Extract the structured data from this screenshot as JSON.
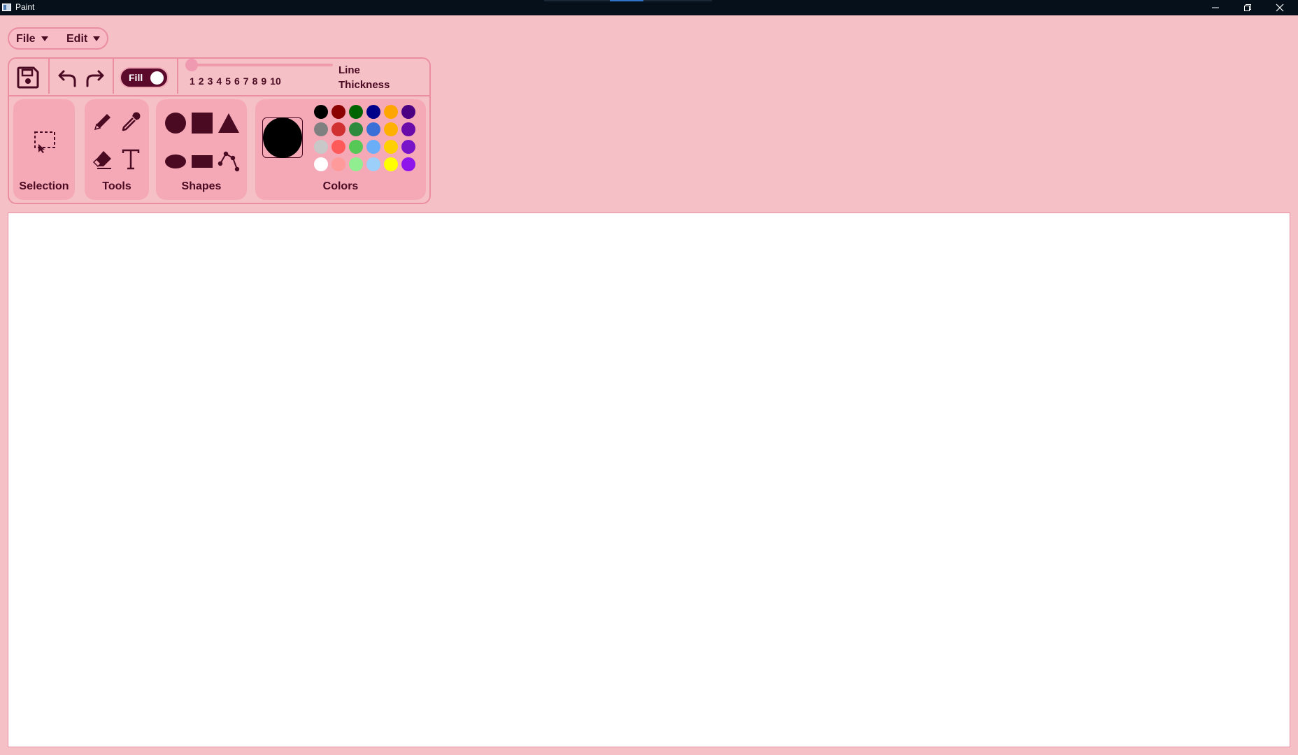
{
  "window": {
    "title": "Paint"
  },
  "menubar": {
    "file_label": "File",
    "edit_label": "Edit"
  },
  "toolbar": {
    "fill_label": "Fill",
    "fill_on": true,
    "thickness_ticks": [
      "1",
      "2",
      "3",
      "4",
      "5",
      "6",
      "7",
      "8",
      "9",
      "10"
    ],
    "thickness_value": 1,
    "thickness_label_line1": "Line",
    "thickness_label_line2": "Thickness"
  },
  "groups": {
    "selection": "Selection",
    "tools": "Tools",
    "shapes": "Shapes",
    "colors": "Colors"
  },
  "colors": {
    "current": "#000000",
    "palette": [
      [
        "#000000",
        "#8b0000",
        "#006400",
        "#00008b",
        "#ffa500",
        "#4b0082"
      ],
      [
        "#808080",
        "#d03030",
        "#2e8b3e",
        "#3a6fd8",
        "#ffb000",
        "#6a0aa8"
      ],
      [
        "#c8c8c8",
        "#ff5a5a",
        "#55c855",
        "#6aaef8",
        "#ffd000",
        "#7a14c8"
      ],
      [
        "#ffffff",
        "#ff9a9a",
        "#90ee90",
        "#9ccffa",
        "#ffff00",
        "#8f14ec"
      ]
    ],
    "accent": "#5c0a2c",
    "border": "#ea8ea4"
  }
}
